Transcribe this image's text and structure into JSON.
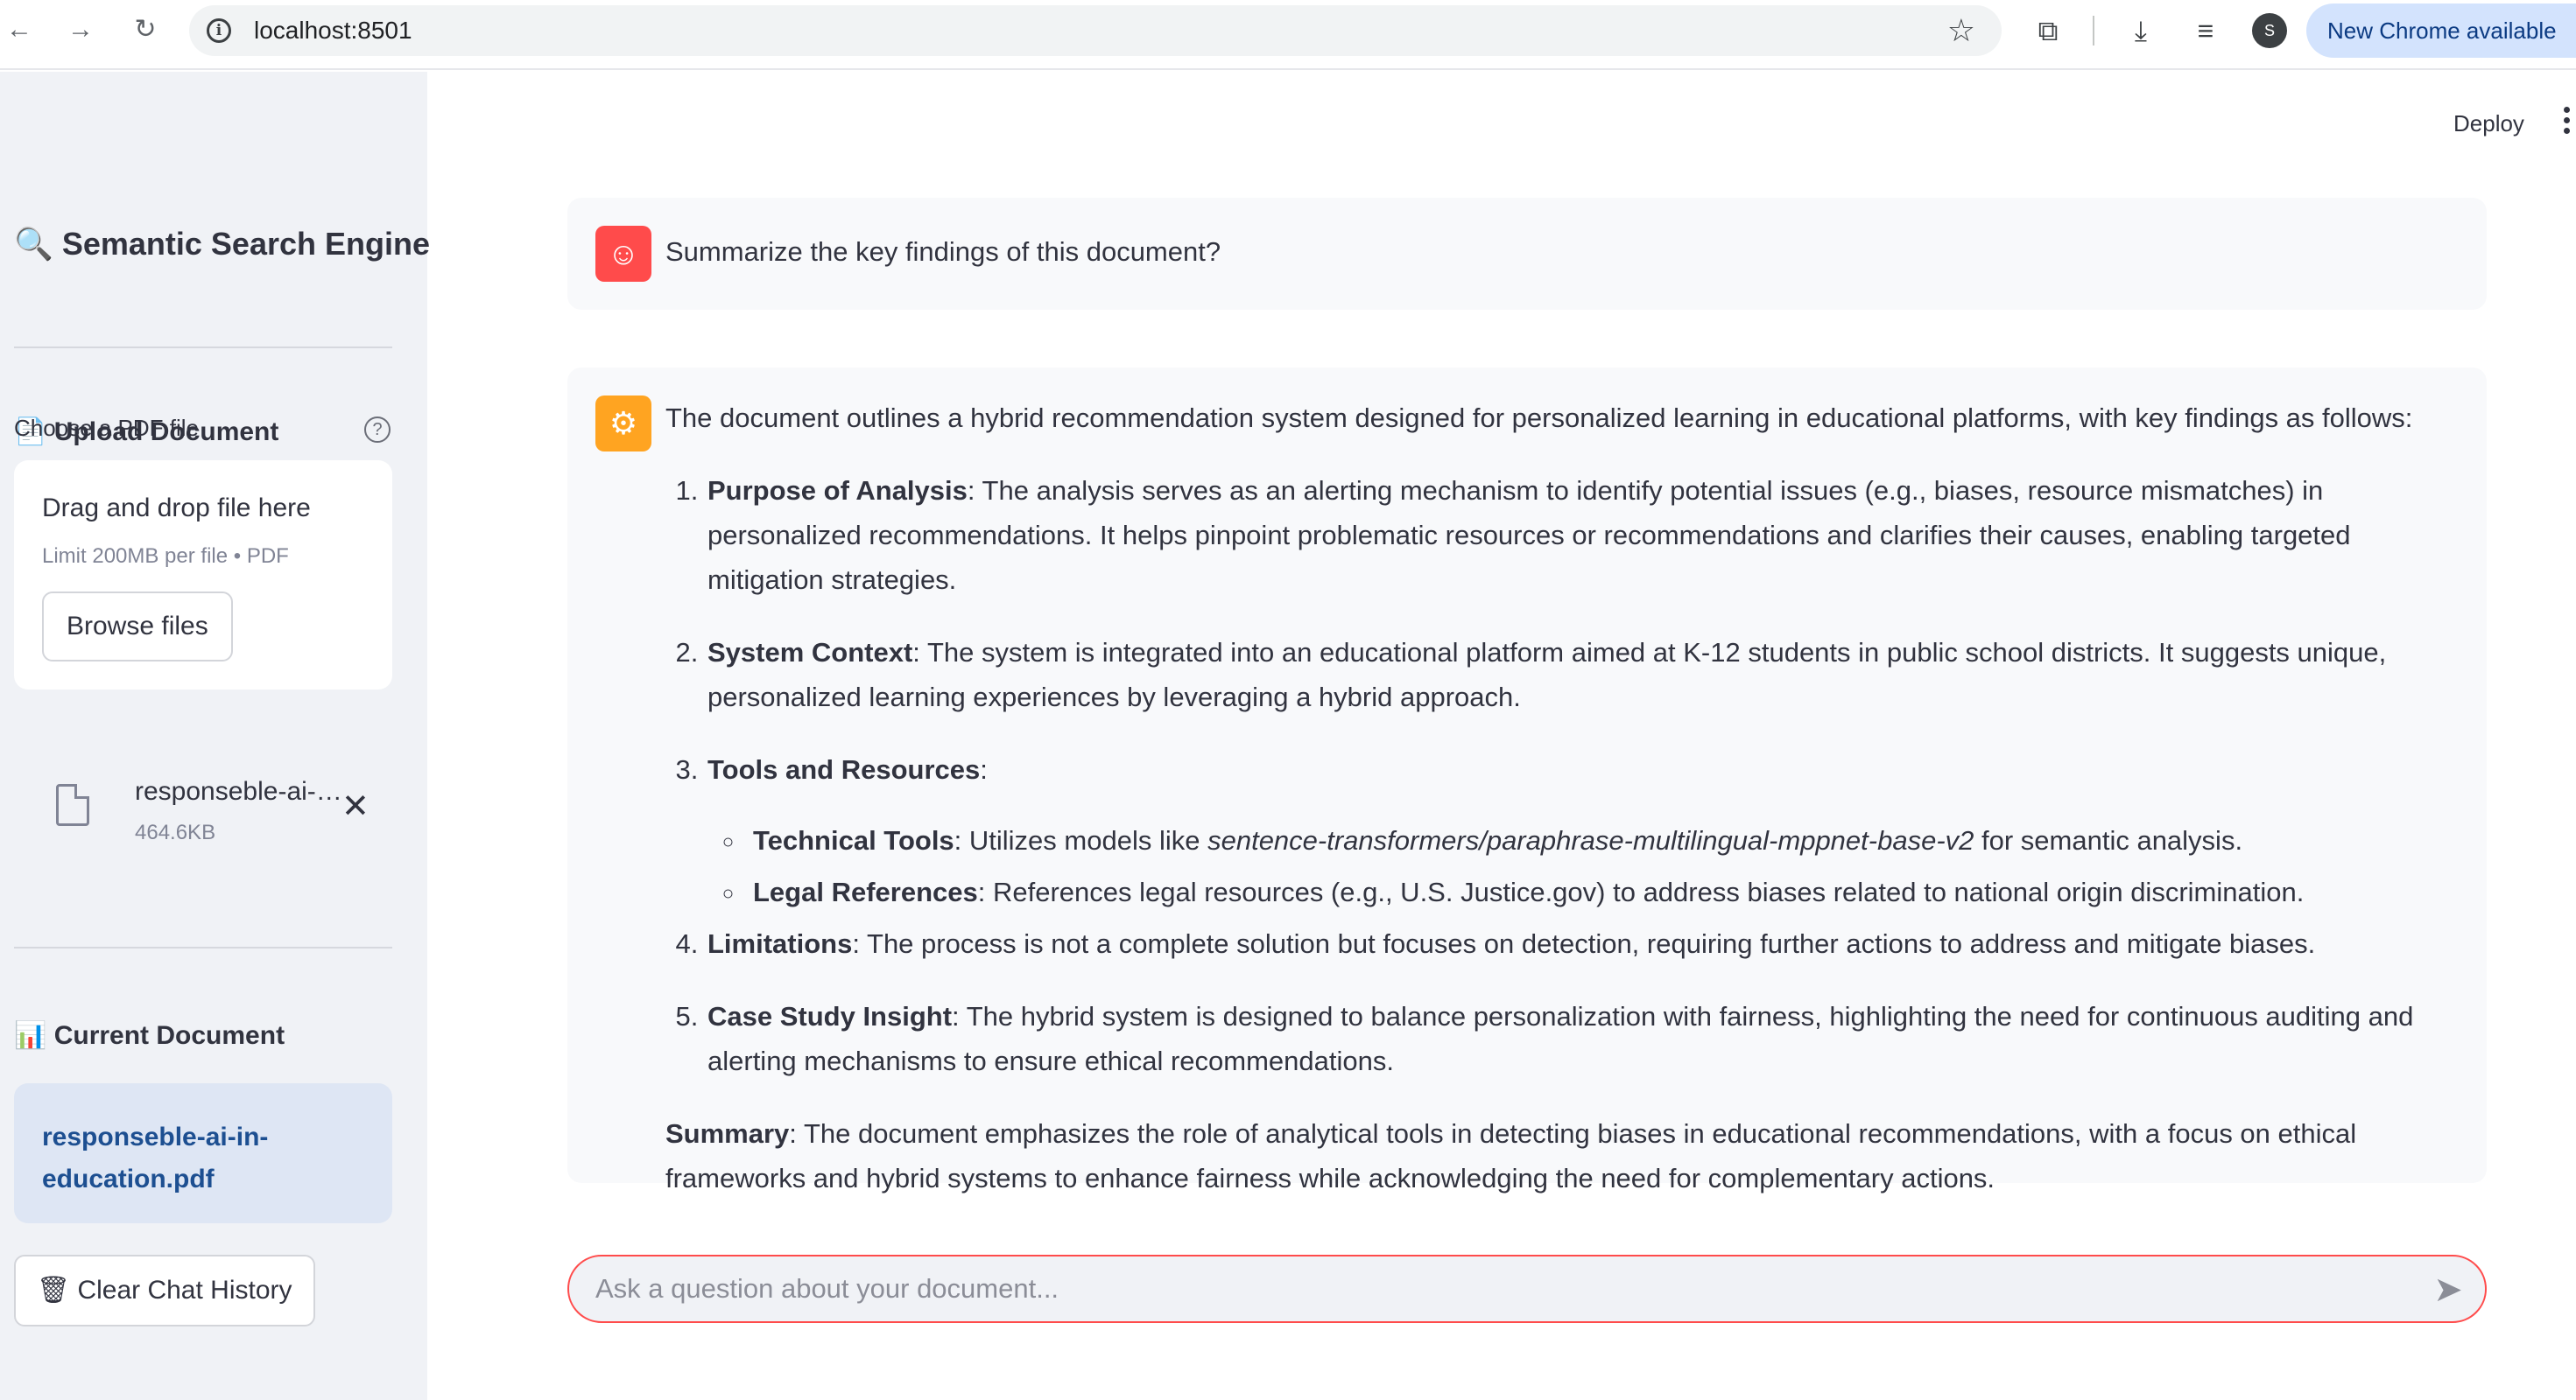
{
  "browser": {
    "url": "localhost:8501",
    "profile_initial": "S",
    "update_label": "New Chrome available"
  },
  "sidebar": {
    "title": "Semantic Search Engine",
    "title_icon": "magnifier-icon",
    "upload_section": {
      "heading": "Upload Document",
      "heading_icon": "page-icon",
      "uploader_label": "Choose a PDF file",
      "dropzone_title": "Drag and drop file here",
      "dropzone_limit": "Limit 200MB per file • PDF",
      "browse_label": "Browse files",
      "uploaded_file": {
        "name": "responseble-ai-in-education.pdf",
        "size": "464.6KB"
      }
    },
    "current_section": {
      "heading": "Current Document",
      "heading_icon": "bar-chart-icon",
      "document_name": "responseble-ai-in-education.pdf"
    },
    "clear_label": "Clear Chat History",
    "clear_icon": "wastebasket-icon"
  },
  "header": {
    "deploy_label": "Deploy"
  },
  "chat": {
    "user_message": "Summarize the key findings of this document?",
    "assistant": {
      "intro": "The document outlines a hybrid recommendation system designed for personalized learning in educational platforms, with key findings as follows:",
      "findings": [
        {
          "title": "Purpose of Analysis",
          "text": ": The analysis serves as an alerting mechanism to identify potential issues (e.g., biases, resource mismatches) in personalized recommendations. It helps pinpoint problematic resources or recommendations and clarifies their causes, enabling targeted mitigation strategies."
        },
        {
          "title": "System Context",
          "text": ": The system is integrated into an educational platform aimed at K-12 students in public school districts. It suggests unique, personalized learning experiences by leveraging a hybrid approach."
        },
        {
          "title": "Tools and Resources",
          "text": ":",
          "sub": [
            {
              "title": "Technical Tools",
              "pre": ": Utilizes models like ",
              "model": "sentence-transformers/paraphrase-multilingual-mppnet-base-v2",
              "post": " for semantic analysis."
            },
            {
              "title": "Legal References",
              "pre": ": References legal resources (e.g., U.S. Justice.gov) to address biases related to national origin discrimination."
            }
          ]
        },
        {
          "title": "Limitations",
          "text": ": The process is not a complete solution but focuses on detection, requiring further actions to address and mitigate biases."
        },
        {
          "title": "Case Study Insight",
          "text": ": The hybrid system is designed to balance personalization with fairness, highlighting the need for continuous auditing and alerting mechanisms to ensure ethical recommendations."
        }
      ],
      "summary_title": "Summary",
      "summary_text": ": The document emphasizes the role of analytical tools in detecting biases in educational recommendations, with a focus on ethical frameworks and hybrid systems to enhance fairness while acknowledging the need for complementary actions."
    },
    "input_placeholder": "Ask a question about your document..."
  }
}
